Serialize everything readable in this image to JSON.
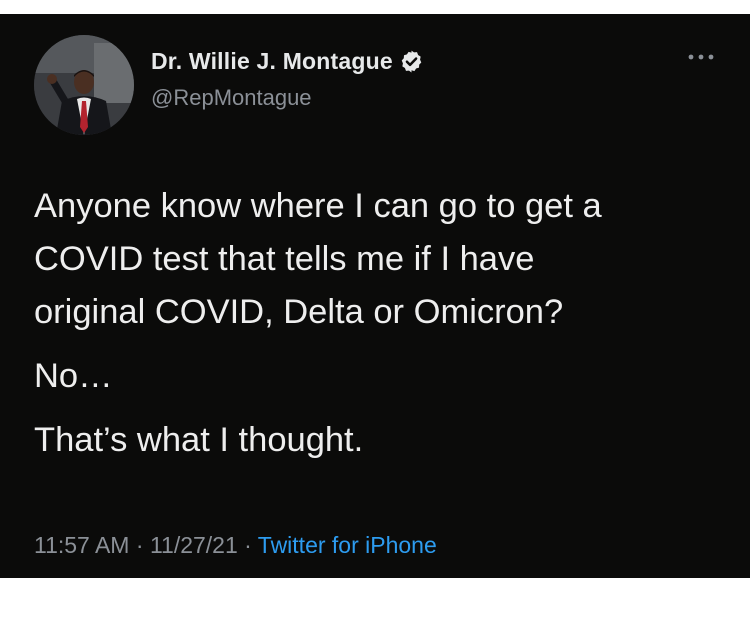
{
  "author": {
    "display_name": "Dr. Willie J. Montague",
    "handle": "@RepMontague",
    "verified": true,
    "avatar_icon": "profile-photo"
  },
  "tweet": {
    "paragraph1_lines": [
      "Anyone know where I can go to get a",
      "COVID test that tells me if I have",
      "original COVID, Delta or Omicron?"
    ],
    "paragraph2": "No…",
    "paragraph3": "That’s what I thought."
  },
  "meta": {
    "time": "11:57 AM",
    "separator": " · ",
    "date": "11/27/21",
    "source": "Twitter for iPhone"
  },
  "icons": {
    "more": "more-options-icon",
    "verified": "verified-badge-icon"
  },
  "colors": {
    "background": "#0b0b0a",
    "text": "#e7e9ea",
    "secondary_text": "#8b9097",
    "link": "#2d9cf0",
    "verified_badge": "#e7e9ea"
  }
}
